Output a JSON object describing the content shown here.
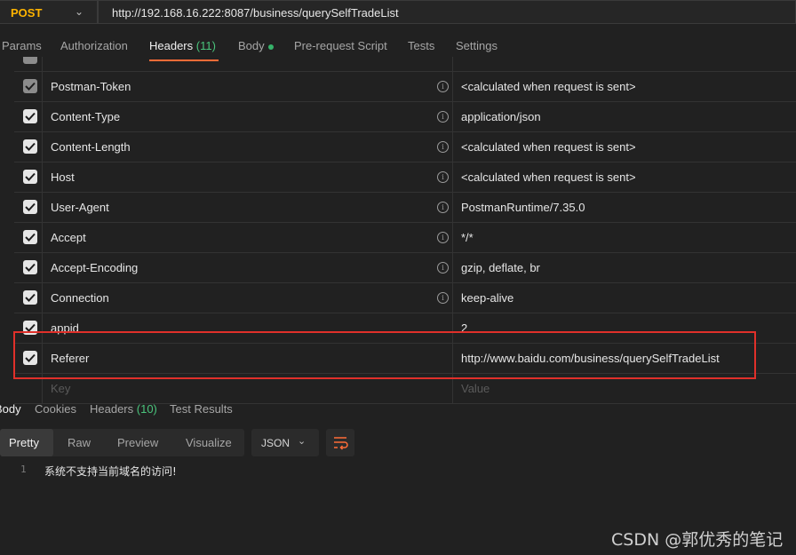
{
  "request": {
    "method": "POST",
    "url": "http://192.168.16.222:8087/business/querySelfTradeList"
  },
  "tabs": [
    {
      "label": "Params"
    },
    {
      "label": "Authorization"
    },
    {
      "label": "Headers",
      "count": "(11)"
    },
    {
      "label": "Body"
    },
    {
      "label": "Pre-request Script"
    },
    {
      "label": "Tests"
    },
    {
      "label": "Settings"
    }
  ],
  "headers": [
    {
      "key": "Postman-Token",
      "value": "<calculated when request is sent>",
      "checked": true,
      "disabled": true
    },
    {
      "key": "Content-Type",
      "value": "application/json",
      "checked": true
    },
    {
      "key": "Content-Length",
      "value": "<calculated when request is sent>",
      "checked": true
    },
    {
      "key": "Host",
      "value": "<calculated when request is sent>",
      "checked": true
    },
    {
      "key": "User-Agent",
      "value": "PostmanRuntime/7.35.0",
      "checked": true
    },
    {
      "key": "Accept",
      "value": "*/*",
      "checked": true
    },
    {
      "key": "Accept-Encoding",
      "value": "gzip, deflate, br",
      "checked": true
    },
    {
      "key": "Connection",
      "value": "keep-alive",
      "checked": true
    },
    {
      "key": "appid",
      "value": "2",
      "checked": true
    },
    {
      "key": "Referer",
      "value": "http://www.baidu.com/business/querySelfTradeList",
      "checked": true
    }
  ],
  "new_row": {
    "key_placeholder": "Key",
    "value_placeholder": "Value"
  },
  "response": {
    "tabs": [
      {
        "label": "Body"
      },
      {
        "label": "Cookies"
      },
      {
        "label": "Headers",
        "count": "(10)"
      },
      {
        "label": "Test Results"
      }
    ],
    "views": [
      "Pretty",
      "Raw",
      "Preview",
      "Visualize"
    ],
    "format": "JSON",
    "lines": [
      {
        "num": "1",
        "text": "系统不支持当前域名的访问!"
      }
    ]
  },
  "watermark": "CSDN @郭优秀的笔记",
  "colors": {
    "accent": "#ff6c37",
    "method": "#ffb400",
    "count": "#4ac47c",
    "highlight": "#e0302a"
  }
}
